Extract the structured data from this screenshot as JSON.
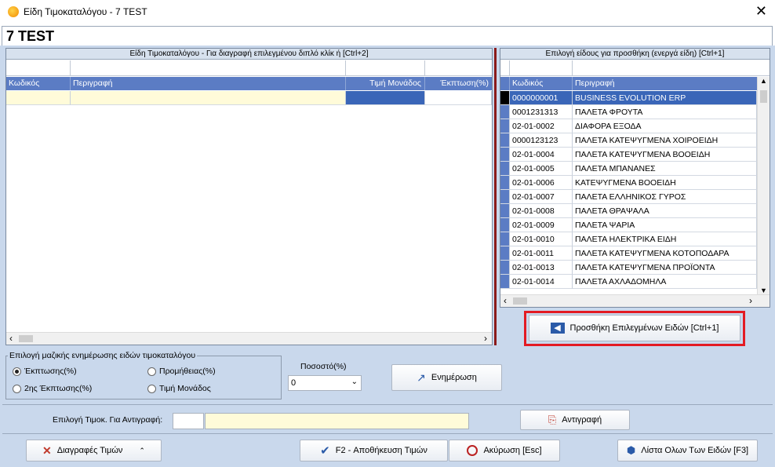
{
  "window": {
    "title": "Είδη Τιμοκαταλόγου - 7  TEST",
    "close_symbol": "✕"
  },
  "header": {
    "title": "7  TEST"
  },
  "left_panel": {
    "caption": "Είδη Τιμοκαταλόγου - Για διαγραφή επιλεγμένου διπλό κλίκ ή [Ctrl+2]",
    "columns": [
      "Κωδικός",
      "Περιγραφή",
      "Τιμή Μονάδος",
      "Έκπτωση(%)"
    ]
  },
  "right_panel": {
    "caption": "Επιλογή είδους για προσθήκη (ενεργά είδη) [Ctrl+1]",
    "columns": [
      "Κωδικός",
      "Περιγραφή"
    ],
    "rows": [
      {
        "code": "0000000001",
        "desc": "BUSINESS EVOLUTION ERP"
      },
      {
        "code": "0001231313",
        "desc": "ΠΑΛΕΤΑ ΦΡΟΥΤΑ"
      },
      {
        "code": "02-01-0002",
        "desc": "ΔΙΑΦΟΡΑ ΕΞΟΔΑ"
      },
      {
        "code": "0000123123",
        "desc": "ΠΑΛΕΤΑ ΚΑΤΕΨΥΓΜΕΝΑ ΧΟΙΡΟΕΙΔΗ"
      },
      {
        "code": "02-01-0004",
        "desc": "ΠΑΛΕΤΑ ΚΑΤΕΨΥΓΜΕΝΑ ΒΟΟΕΙΔΗ"
      },
      {
        "code": "02-01-0005",
        "desc": "ΠΑΛΕΤΑ ΜΠΑΝΑΝΕΣ"
      },
      {
        "code": "02-01-0006",
        "desc": "ΚΑΤΕΨΥΓΜΕΝΑ ΒΟΟΕΙΔΗ"
      },
      {
        "code": "02-01-0007",
        "desc": "ΠΑΛΕΤΑ ΕΛΛΗΝΙΚΟΣ ΓΥΡΟΣ"
      },
      {
        "code": "02-01-0008",
        "desc": "ΠΑΛΕΤΑ ΘΡΑΨΑΛΑ"
      },
      {
        "code": "02-01-0009",
        "desc": "ΠΑΛΕΤΑ ΨΑΡΙΑ"
      },
      {
        "code": "02-01-0010",
        "desc": "ΠΑΛΕΤΑ ΗΛΕΚΤΡΙΚΑ ΕΙΔΗ"
      },
      {
        "code": "02-01-0011",
        "desc": "ΠΑΛΕΤΑ ΚΑΤΕΨΥΓΜΕΝΑ ΚΟΤΟΠΟΔΑΡΑ"
      },
      {
        "code": "02-01-0013",
        "desc": "ΠΑΛΕΤΑ ΚΑΤΕΨΥΓΜΕΝΑ ΠΡΟΪΟΝΤΑ"
      },
      {
        "code": "02-01-0014",
        "desc": "ΠΑΛΕΤΑ ΑΧΛΑΔΟΜΗΛΑ"
      }
    ],
    "add_button": "Προσθήκη Επιλεγμένων Ειδών [Ctrl+1]"
  },
  "bulk": {
    "legend": "Επιλογή μαζικής ενημέρωσης ειδών τιμοκαταλόγου",
    "options": [
      "Έκπτωσης(%)",
      "Προμήθειας(%)",
      "2ης Έκπτωσης(%)",
      "Τιμή Μονάδος"
    ],
    "selected": "Έκπτωσης(%)",
    "percent_label": "Ποσοστό(%)",
    "percent_value": "0",
    "update_button": "Ενημέρωση"
  },
  "copy": {
    "label": "Επιλογή Τιμοκ. Για Αντιγραφή:",
    "code_value": "",
    "name_value": "",
    "button": "Αντιγραφή"
  },
  "footer": {
    "delete_button": "Διαγραφές Τιμών",
    "save_button": "F2 - Αποθήκευση Τιμών",
    "cancel_button": "Ακύρωση [Esc]",
    "list_button": "Λίστα Ολων Των Ειδών [F3]"
  },
  "colors": {
    "accent": "#5b7cc4",
    "highlight": "#e31b23",
    "selected_row": "#3a66b8"
  }
}
